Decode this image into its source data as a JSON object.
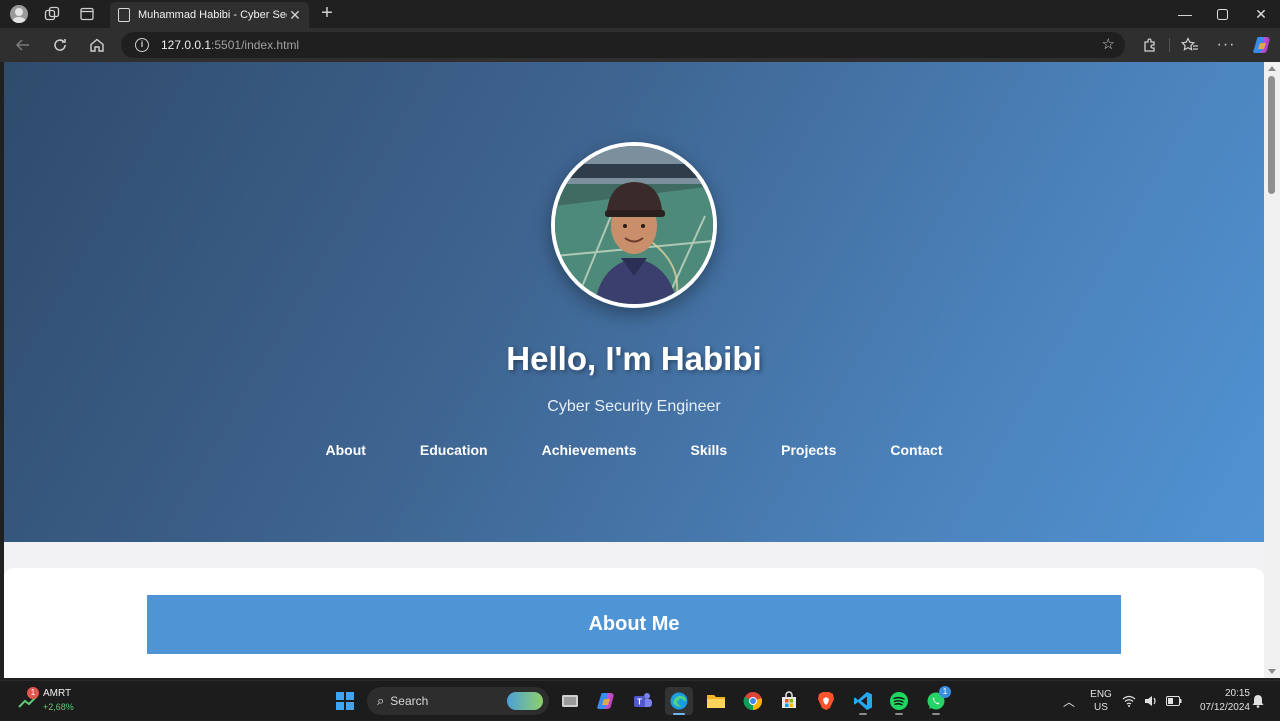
{
  "browser": {
    "tab_title": "Muhammad Habibi - Cyber Secu",
    "url_host": "127.0.0.1",
    "url_rest": ":5501/index.html"
  },
  "hero": {
    "title": "Hello, I'm Habibi",
    "subtitle": "Cyber Security Engineer",
    "nav": [
      "About",
      "Education",
      "Achievements",
      "Skills",
      "Projects",
      "Contact"
    ]
  },
  "about": {
    "heading": "About Me"
  },
  "taskbar": {
    "stock_name": "AMRT",
    "stock_change": "+2,68%",
    "stock_badge": "1",
    "search_label": "Search",
    "whatsapp_badge": "1",
    "lang_line1": "ENG",
    "lang_line2": "US",
    "time": "20:15",
    "date": "07/12/2024"
  },
  "colors": {
    "hero_gradient_start": "#2f4b6c",
    "hero_gradient_end": "#5093d3",
    "about_header_bg": "#4f94d4"
  }
}
